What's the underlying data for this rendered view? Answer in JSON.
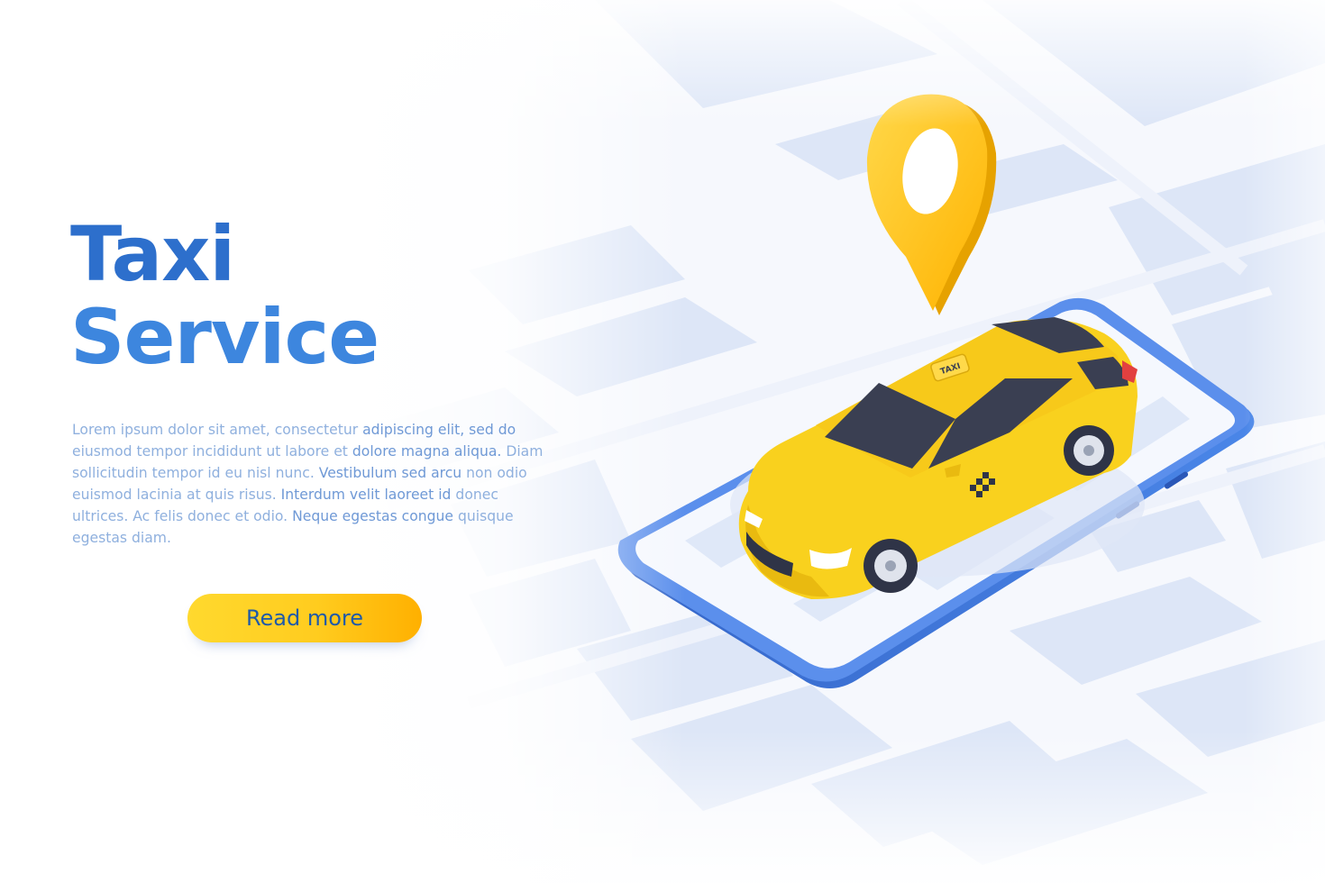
{
  "hero": {
    "title_line1": "Taxi",
    "title_line2": "Service",
    "body": [
      {
        "t": "Lorem ipsum dolor sit amet, consectetur ",
        "b": false
      },
      {
        "t": "adipiscing elit, sed do",
        "b": true
      },
      {
        "t": " eiusmod tempor incididunt ut labore et ",
        "b": false
      },
      {
        "t": "dolore magna aliqua.",
        "b": true
      },
      {
        "t": " Diam sollicitudin tempor id eu nisl nunc. ",
        "b": false
      },
      {
        "t": "Vestibulum sed arcu",
        "b": true
      },
      {
        "t": " non odio euismod lacinia at quis risus. ",
        "b": false
      },
      {
        "t": "Interdum velit laoreet id",
        "b": true
      },
      {
        "t": " donec ultrices. Ac felis donec et odio. ",
        "b": false
      },
      {
        "t": "Neque egestas congue",
        "b": true
      },
      {
        "t": " quisque egestas diam.",
        "b": false
      }
    ],
    "button_label": "Read more"
  },
  "illustration": {
    "roof_sign": "TAXI",
    "icons": [
      "map-background",
      "location-pin-icon",
      "smartphone",
      "taxi-car"
    ]
  },
  "colors": {
    "title": "#2d6fcc",
    "body_text": "#8fb0de",
    "button": "#ffcc1f",
    "button_text": "#1f5aa8",
    "phone_frame": "#3f73d6",
    "taxi": "#f9d11e",
    "pin": "#ffc21a",
    "map_block": "#dde6f7",
    "road": "#f6f8fd"
  }
}
